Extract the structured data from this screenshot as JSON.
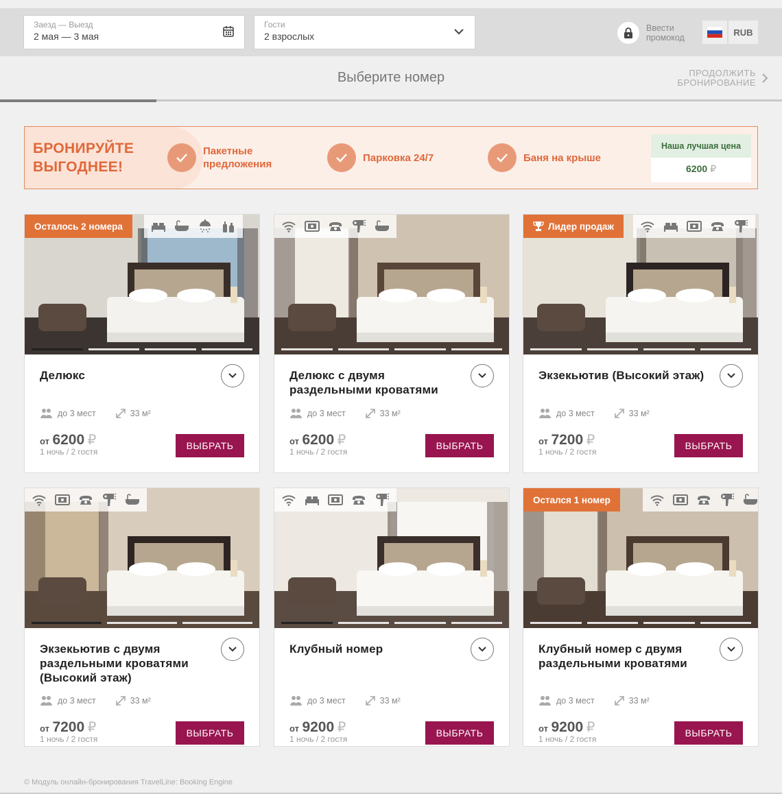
{
  "search": {
    "dates_label": "Заезд — Выезд",
    "dates_value": "2 мая — 3 мая",
    "guests_label": "Гости",
    "guests_value": "2 взрослых",
    "calendar_icon": "calendar-icon",
    "dropdown_icon": "chevron-down-icon"
  },
  "promo": {
    "line1": "Ввести",
    "line2": "промокод",
    "icon": "lock-icon"
  },
  "currency": {
    "code": "RUB",
    "flag": "russia-flag"
  },
  "steps": {
    "title": "Выберите номер",
    "continue_line1": "ПРОДОЛЖИТЬ",
    "continue_line2": "БРОНИРОВАНИЕ",
    "progress": 0.2
  },
  "banner": {
    "title_line1": "БРОНИРУЙТЕ",
    "title_line2": "ВЫГОДНЕЕ!",
    "features": [
      {
        "line1": "Пакетные",
        "line2": "предложения"
      },
      {
        "line1": "Парковка 24/7",
        "line2": ""
      },
      {
        "line1": "Баня на крыше",
        "line2": ""
      }
    ],
    "best_title": "Наша лучшая цена",
    "best_price": "6200",
    "currency_symbol": "₽"
  },
  "colors": {
    "accent": "#e0683a",
    "select_button": "#98154f",
    "badge": "#e07238",
    "best_price_green": "#3c6e3c"
  },
  "rooms": [
    {
      "badge": "Осталось 2 номера",
      "name": "Делюкс",
      "capacity": "до 3 мест",
      "area": "33 м²",
      "from": "от",
      "price": "6200",
      "currency": "₽",
      "per": "1 ночь / 2 гостя",
      "button": "ВЫБРАТЬ",
      "amenities": [
        "bed-icon",
        "bathtub-icon",
        "shower-icon",
        "toiletries-icon"
      ]
    },
    {
      "badge": "",
      "name": "Делюкс с двумя раздельными кроватями",
      "capacity": "до 3 мест",
      "area": "33 м²",
      "from": "от",
      "price": "6200",
      "currency": "₽",
      "per": "1 ночь / 2 гостя",
      "button": "ВЫБРАТЬ",
      "amenities": [
        "wifi-icon",
        "safe-icon",
        "phone-icon",
        "hairdryer-icon",
        "bathtub-icon"
      ]
    },
    {
      "badge": "Лидер продаж",
      "name": "Экзекьютив (Высокий этаж)",
      "capacity": "до 3 мест",
      "area": "33 м²",
      "from": "от",
      "price": "7200",
      "currency": "₽",
      "per": "1 ночь / 2 гостя",
      "button": "ВЫБРАТЬ",
      "amenities": [
        "wifi-icon",
        "bed-icon",
        "safe-icon",
        "phone-icon",
        "hairdryer-icon"
      ]
    },
    {
      "badge": "",
      "name": "Экзекьютив с двумя раздельными кроватями (Высокий этаж)",
      "capacity": "до 3 мест",
      "area": "33 м²",
      "from": "от",
      "price": "7200",
      "currency": "₽",
      "per": "1 ночь / 2 гостя",
      "button": "ВЫБРАТЬ",
      "amenities": [
        "wifi-icon",
        "safe-icon",
        "phone-icon",
        "hairdryer-icon",
        "bathtub-icon"
      ]
    },
    {
      "badge": "",
      "name": "Клубный номер",
      "capacity": "до 3 мест",
      "area": "33 м²",
      "from": "от",
      "price": "9200",
      "currency": "₽",
      "per": "1 ночь / 2 гостя",
      "button": "ВЫБРАТЬ",
      "amenities": [
        "wifi-icon",
        "bed-icon",
        "safe-icon",
        "phone-icon",
        "hairdryer-icon"
      ]
    },
    {
      "badge": "Остался 1 номер",
      "name": "Клубный номер с двумя раздельными кроватями",
      "capacity": "до 3 мест",
      "area": "33 м²",
      "from": "от",
      "price": "9200",
      "currency": "₽",
      "per": "1 ночь / 2 гостя",
      "button": "ВЫБРАТЬ",
      "amenities": [
        "wifi-icon",
        "safe-icon",
        "phone-icon",
        "hairdryer-icon",
        "bathtub-icon"
      ]
    }
  ],
  "footer": "© Модуль онлайн-бронирования TravelLine: Booking Engine"
}
